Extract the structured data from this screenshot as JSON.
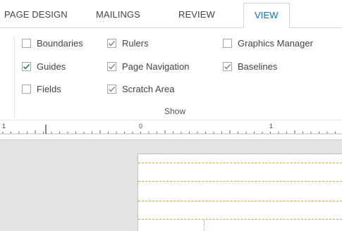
{
  "tabs": [
    {
      "label": "PAGE DESIGN",
      "active": false
    },
    {
      "label": "MAILINGS",
      "active": false
    },
    {
      "label": "REVIEW",
      "active": false
    },
    {
      "label": "VIEW",
      "active": true
    }
  ],
  "ribbon": {
    "group": {
      "label": "Show",
      "checkboxes": [
        {
          "label": "Boundaries",
          "checked": false
        },
        {
          "label": "Guides",
          "checked": true
        },
        {
          "label": "Fields",
          "checked": false
        },
        {
          "label": "Rulers",
          "checked": true
        },
        {
          "label": "Page Navigation",
          "checked": true
        },
        {
          "label": "Scratch Area",
          "checked": true
        },
        {
          "label": "Graphics Manager",
          "checked": false
        },
        {
          "label": "Baselines",
          "checked": true
        }
      ]
    }
  },
  "ruler": {
    "labels": [
      "1",
      "0",
      "1"
    ]
  },
  "colors": {
    "accent": "#0072c6",
    "check_active": "#1e7d47",
    "check_inactive": "#808080",
    "guide_line": "#d9a13a",
    "workspace": "#e4e4e4"
  }
}
